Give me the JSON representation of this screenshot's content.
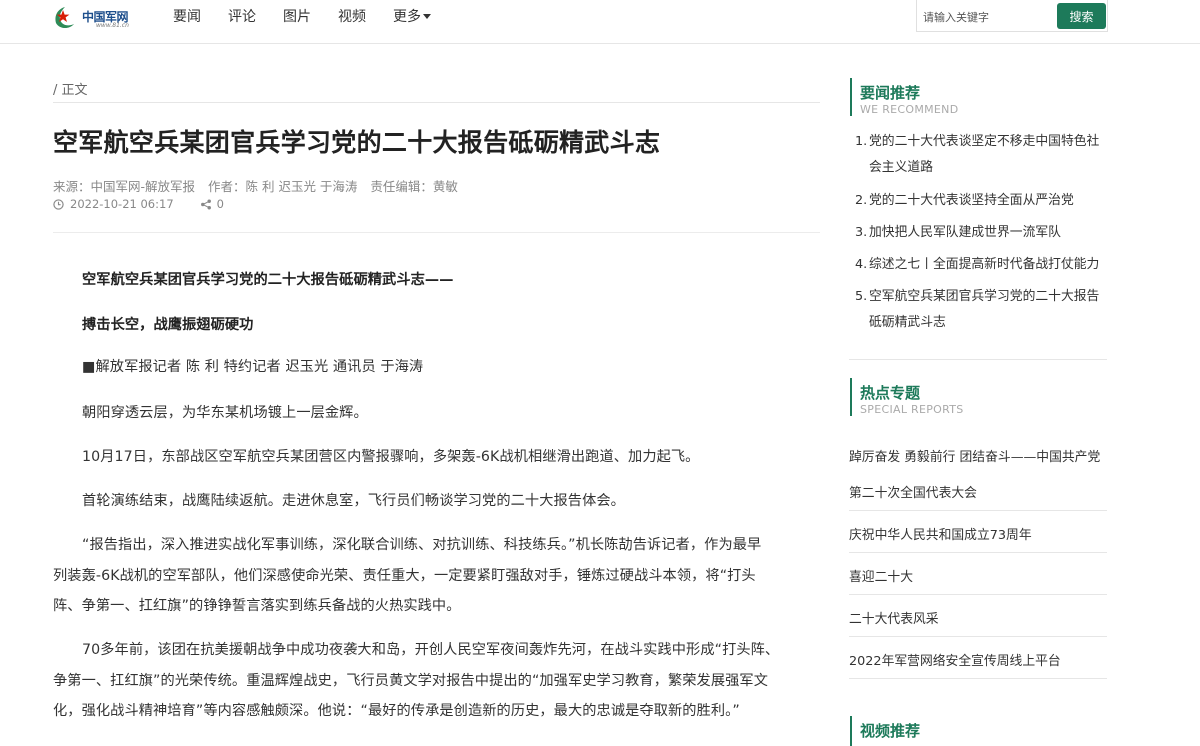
{
  "header": {
    "logo_text": "中国军网",
    "logo_url": "www.81.cn",
    "nav": [
      "要闻",
      "评论",
      "图片",
      "视频",
      "更多"
    ],
    "search_placeholder": "请输入关键字",
    "search_button": "搜索"
  },
  "article": {
    "breadcrumb": "/ 正文",
    "title": "空军航空兵某团官兵学习党的二十大报告砥砺精武斗志",
    "source": "来源：中国军网-解放军报",
    "author": "作者：陈 利 迟玉光 于海涛",
    "editor": "责任编辑：黄敏",
    "datetime": "2022-10-21 06:17",
    "share_count": "0",
    "paragraphs": [
      {
        "lines": [
          "空军航空兵某团官兵学习党的二十大报告砥砺精武斗志——"
        ],
        "bold": true
      },
      {
        "lines": [
          "搏击长空，战鹰振翅砺硬功"
        ],
        "bold": true
      },
      {
        "lines": [
          "■解放军报记者 陈 利 特约记者 迟玉光 通讯员 于海涛"
        ],
        "bold": false
      },
      {
        "lines": [
          "朝阳穿透云层，为华东某机场镀上一层金辉。"
        ],
        "bold": false
      },
      {
        "lines": [
          "10月17日，东部战区空军航空兵某团营区内警报骤响，多架轰-6K战机相继滑出跑道、加力起飞。"
        ],
        "bold": false
      },
      {
        "lines": [
          "首轮演练结束，战鹰陆续返航。走进休息室，飞行员们畅谈学习党的二十大报告体会。"
        ],
        "bold": false
      },
      {
        "lines": [
          "“报告指出，深入推进实战化军事训练，深化联合训练、对抗训练、科技练兵。”机长陈劼告诉记者，作为最早",
          "列装轰-6K战机的空军部队，他们深感使命光荣、责任重大，一定要紧盯强敌对手，锤炼过硬战斗本领，将“打头",
          "阵、争第一、扛红旗”的铮铮誓言落实到练兵备战的火热实践中。"
        ],
        "bold": false
      },
      {
        "lines": [
          "70多年前，该团在抗美援朝战争中成功夜袭大和岛，开创人民空军夜间轰炸先河，在战斗实践中形成“打头阵、",
          "争第一、扛红旗”的光荣传统。重温辉煌战史，飞行员黄文学对报告中提出的“加强军史学习教育，繁荣发展强军文",
          "化，强化战斗精神培育”等内容感触颇深。他说：“最好的传承是创造新的历史，最大的忠诚是夺取新的胜利。”"
        ],
        "bold": false
      }
    ]
  },
  "sidebar": {
    "recommend_title": "要闻推荐",
    "recommend_sub": "WE RECOMMEND",
    "recommend": [
      {
        "num": "1.",
        "text": "党的二十大代表谈坚定不移走中国特色社会主义道路"
      },
      {
        "num": "2.",
        "text": "党的二十大代表谈坚持全面从严治党"
      },
      {
        "num": "3.",
        "text": "加快把人民军队建成世界一流军队"
      },
      {
        "num": "4.",
        "text": "综述之七丨全面提高新时代备战打仗能力"
      },
      {
        "num": "5.",
        "text": "空军航空兵某团官兵学习党的二十大报告砥砺精武斗志"
      }
    ],
    "special_title": "热点专题",
    "special_sub": "SPECIAL REPORTS",
    "special": [
      "踔厉奋发 勇毅前行 团结奋斗——中国共产党",
      "第二十次全国代表大会",
      "庆祝中华人民共和国成立73周年",
      "喜迎二十大",
      "二十大代表风采",
      "2022年军营网络安全宣传周线上平台"
    ],
    "video_title": "视频推荐"
  },
  "colors": {
    "accent": "#1d7a5a",
    "title": "#222222",
    "meta": "#888888"
  }
}
